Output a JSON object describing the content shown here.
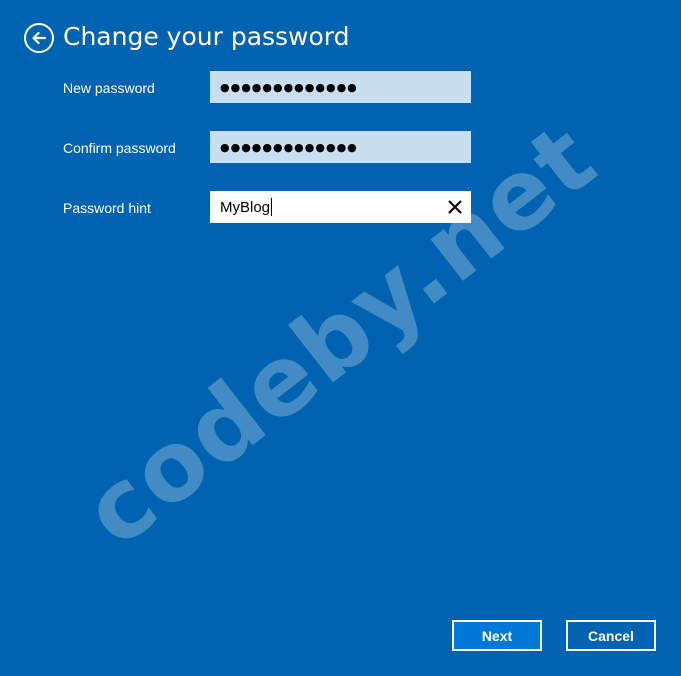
{
  "dialog": {
    "title": "Change your password",
    "back_icon": "back-arrow-icon"
  },
  "fields": {
    "new_password": {
      "label": "New password",
      "masked_value": "●●●●●●●●●●●●●"
    },
    "confirm_password": {
      "label": "Confirm password",
      "masked_value": "●●●●●●●●●●●●●"
    },
    "password_hint": {
      "label": "Password hint",
      "value": "MyBlog",
      "clear_icon": "close-icon"
    }
  },
  "watermark": {
    "text": "codeby.net"
  },
  "buttons": {
    "next_label": "Next",
    "cancel_label": "Cancel"
  },
  "colors": {
    "background": "#0063b1",
    "password_field": "#c9dff0",
    "hint_field": "#ffffff",
    "primary_button": "#0078d7",
    "text": "#ffffff"
  }
}
